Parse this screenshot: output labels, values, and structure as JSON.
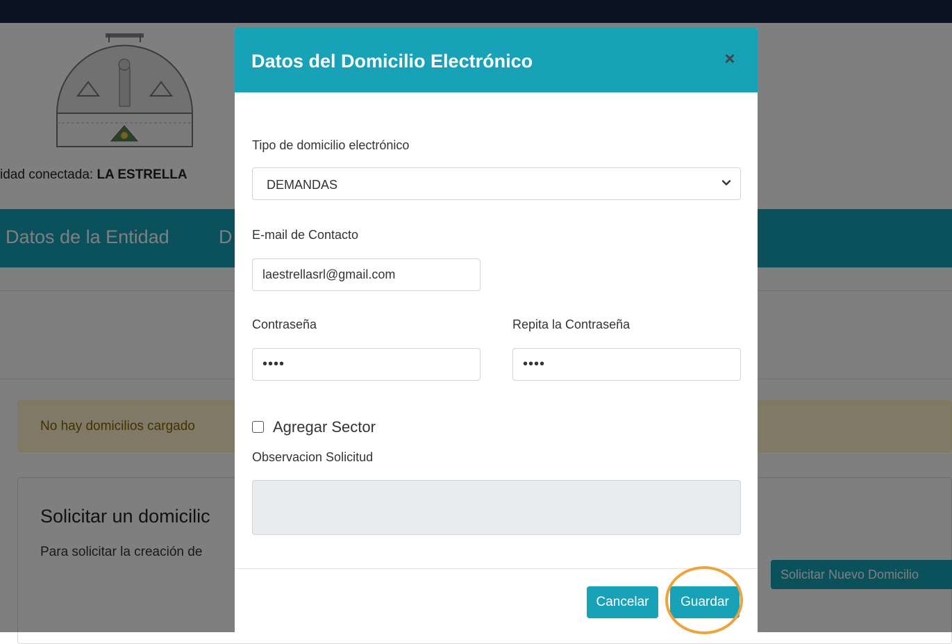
{
  "page": {
    "entity_prefix": "idad conectada: ",
    "entity_name": "LA ESTRELLA",
    "nav": {
      "item1": "Datos de la Entidad",
      "item2": "D"
    },
    "alert_text": "No hay domicilios cargado",
    "card": {
      "title": "Solicitar un domicilic",
      "text": "Para solicitar la creación de",
      "button": "Solicitar Nuevo Domicilio"
    }
  },
  "modal": {
    "title": "Datos del Domicilio Electrónico",
    "close_glyph": "×",
    "tipo_label": "Tipo de domicilio electrónico",
    "tipo_value": "DEMANDAS",
    "email_label": "E-mail de Contacto",
    "email_value": "laestrellasrl@gmail.com",
    "password_label": "Contraseña",
    "password_mask": "••••",
    "repeat_label": "Repita la Contraseña",
    "repeat_mask": "••••",
    "checkbox_label": "Agregar Sector",
    "observacion_label": "Observacion Solicitud",
    "cancel_label": "Cancelar",
    "save_label": "Guardar"
  },
  "colors": {
    "accent": "#17a2b8",
    "topbar": "#162640",
    "highlight": "#f0a33a",
    "alert_bg": "#fff3cd"
  },
  "icons": {
    "close": "close-icon",
    "select": "chevron-down-icon",
    "logo": "coat-of-arms-logo"
  }
}
